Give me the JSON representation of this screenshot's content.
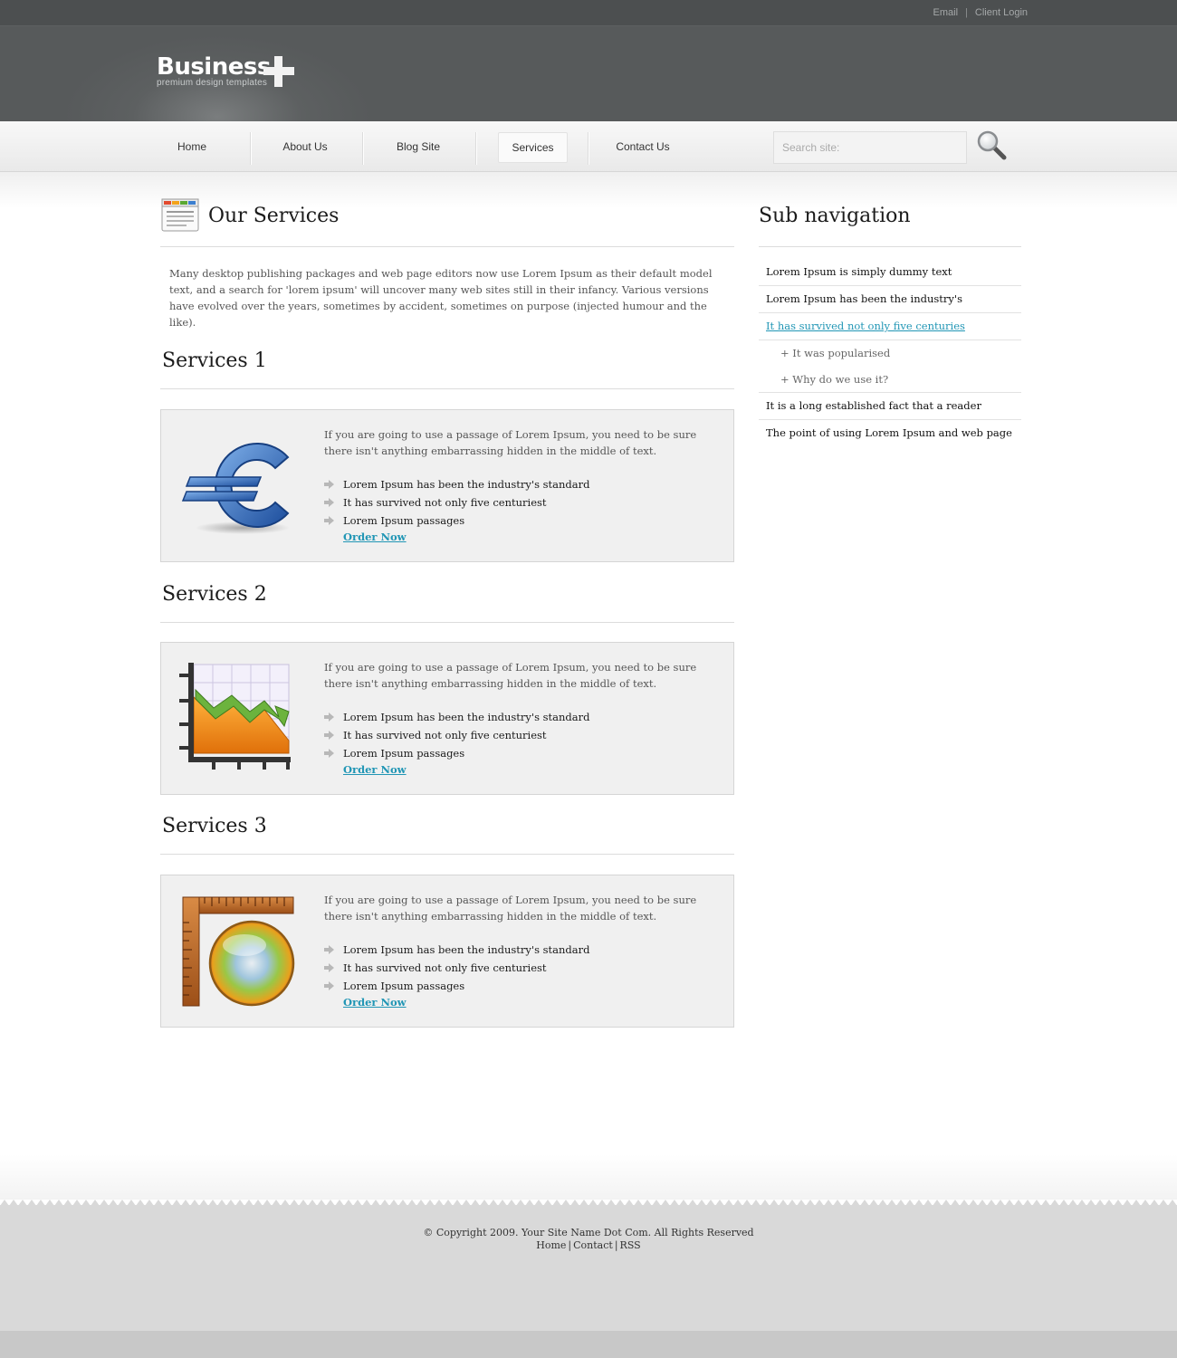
{
  "topbar": {
    "links": [
      "Email",
      "Client Login"
    ],
    "separator": "|"
  },
  "brand": {
    "name": "Business",
    "tagline": "premium design templates"
  },
  "nav": {
    "items": [
      "Home",
      "About Us",
      "Blog Site",
      "Services",
      "Contact Us"
    ],
    "active": "Services",
    "search_placeholder": "Search site:"
  },
  "page": {
    "title": "Our Services",
    "intro": "Many desktop publishing packages and web page editors now use Lorem Ipsum as their default model text, and a search for 'lorem ipsum' will uncover many web sites still in their infancy. Various versions have evolved over the years, sometimes by accident, sometimes on purpose (injected humour and the like)."
  },
  "services": [
    {
      "title": "Services 1",
      "icon": "euro-icon",
      "text": "If you are going to use a passage of Lorem Ipsum, you need to be sure there isn't anything embarrassing hidden in the middle of text.",
      "bullets": [
        "Lorem Ipsum has been the industry's standard",
        "It has survived not only five centuriest",
        "Lorem Ipsum passages"
      ],
      "link": "Order Now"
    },
    {
      "title": "Services 2",
      "icon": "chart-icon",
      "text": "If you are going to use a passage of Lorem Ipsum, you need to be sure there isn't anything embarrassing hidden in the middle of text.",
      "bullets": [
        "Lorem Ipsum has been the industry's standard",
        "It has survived not only five centuriest",
        "Lorem Ipsum passages"
      ],
      "link": "Order Now"
    },
    {
      "title": "Services 3",
      "icon": "ruler-color-wheel-icon",
      "text": "If you are going to use a passage of Lorem Ipsum, you need to be sure there isn't anything embarrassing hidden in the middle of text.",
      "bullets": [
        "Lorem Ipsum has been the industry's standard",
        "It has survived not only five centuriest",
        "Lorem Ipsum passages"
      ],
      "link": "Order Now"
    }
  ],
  "sidebar": {
    "title": "Sub navigation",
    "items": [
      "Lorem Ipsum is simply dummy text",
      "Lorem Ipsum has been the industry's",
      "It has survived not only five centuries",
      "It is a long established fact that a reader",
      "The point of using Lorem Ipsum and web page"
    ],
    "subitems": [
      "+ It was popularised",
      "+ Why do we use it?"
    ]
  },
  "footer": {
    "copyright": "© Copyright 2009. Your Site Name Dot Com. All Rights Reserved",
    "links": [
      "Home",
      "Contact",
      "RSS"
    ],
    "separator": "|"
  },
  "colors": {
    "link": "#2196b5",
    "header": "#5d6061",
    "topbar": "#4c4f50",
    "footer": "#d9d9d9"
  }
}
